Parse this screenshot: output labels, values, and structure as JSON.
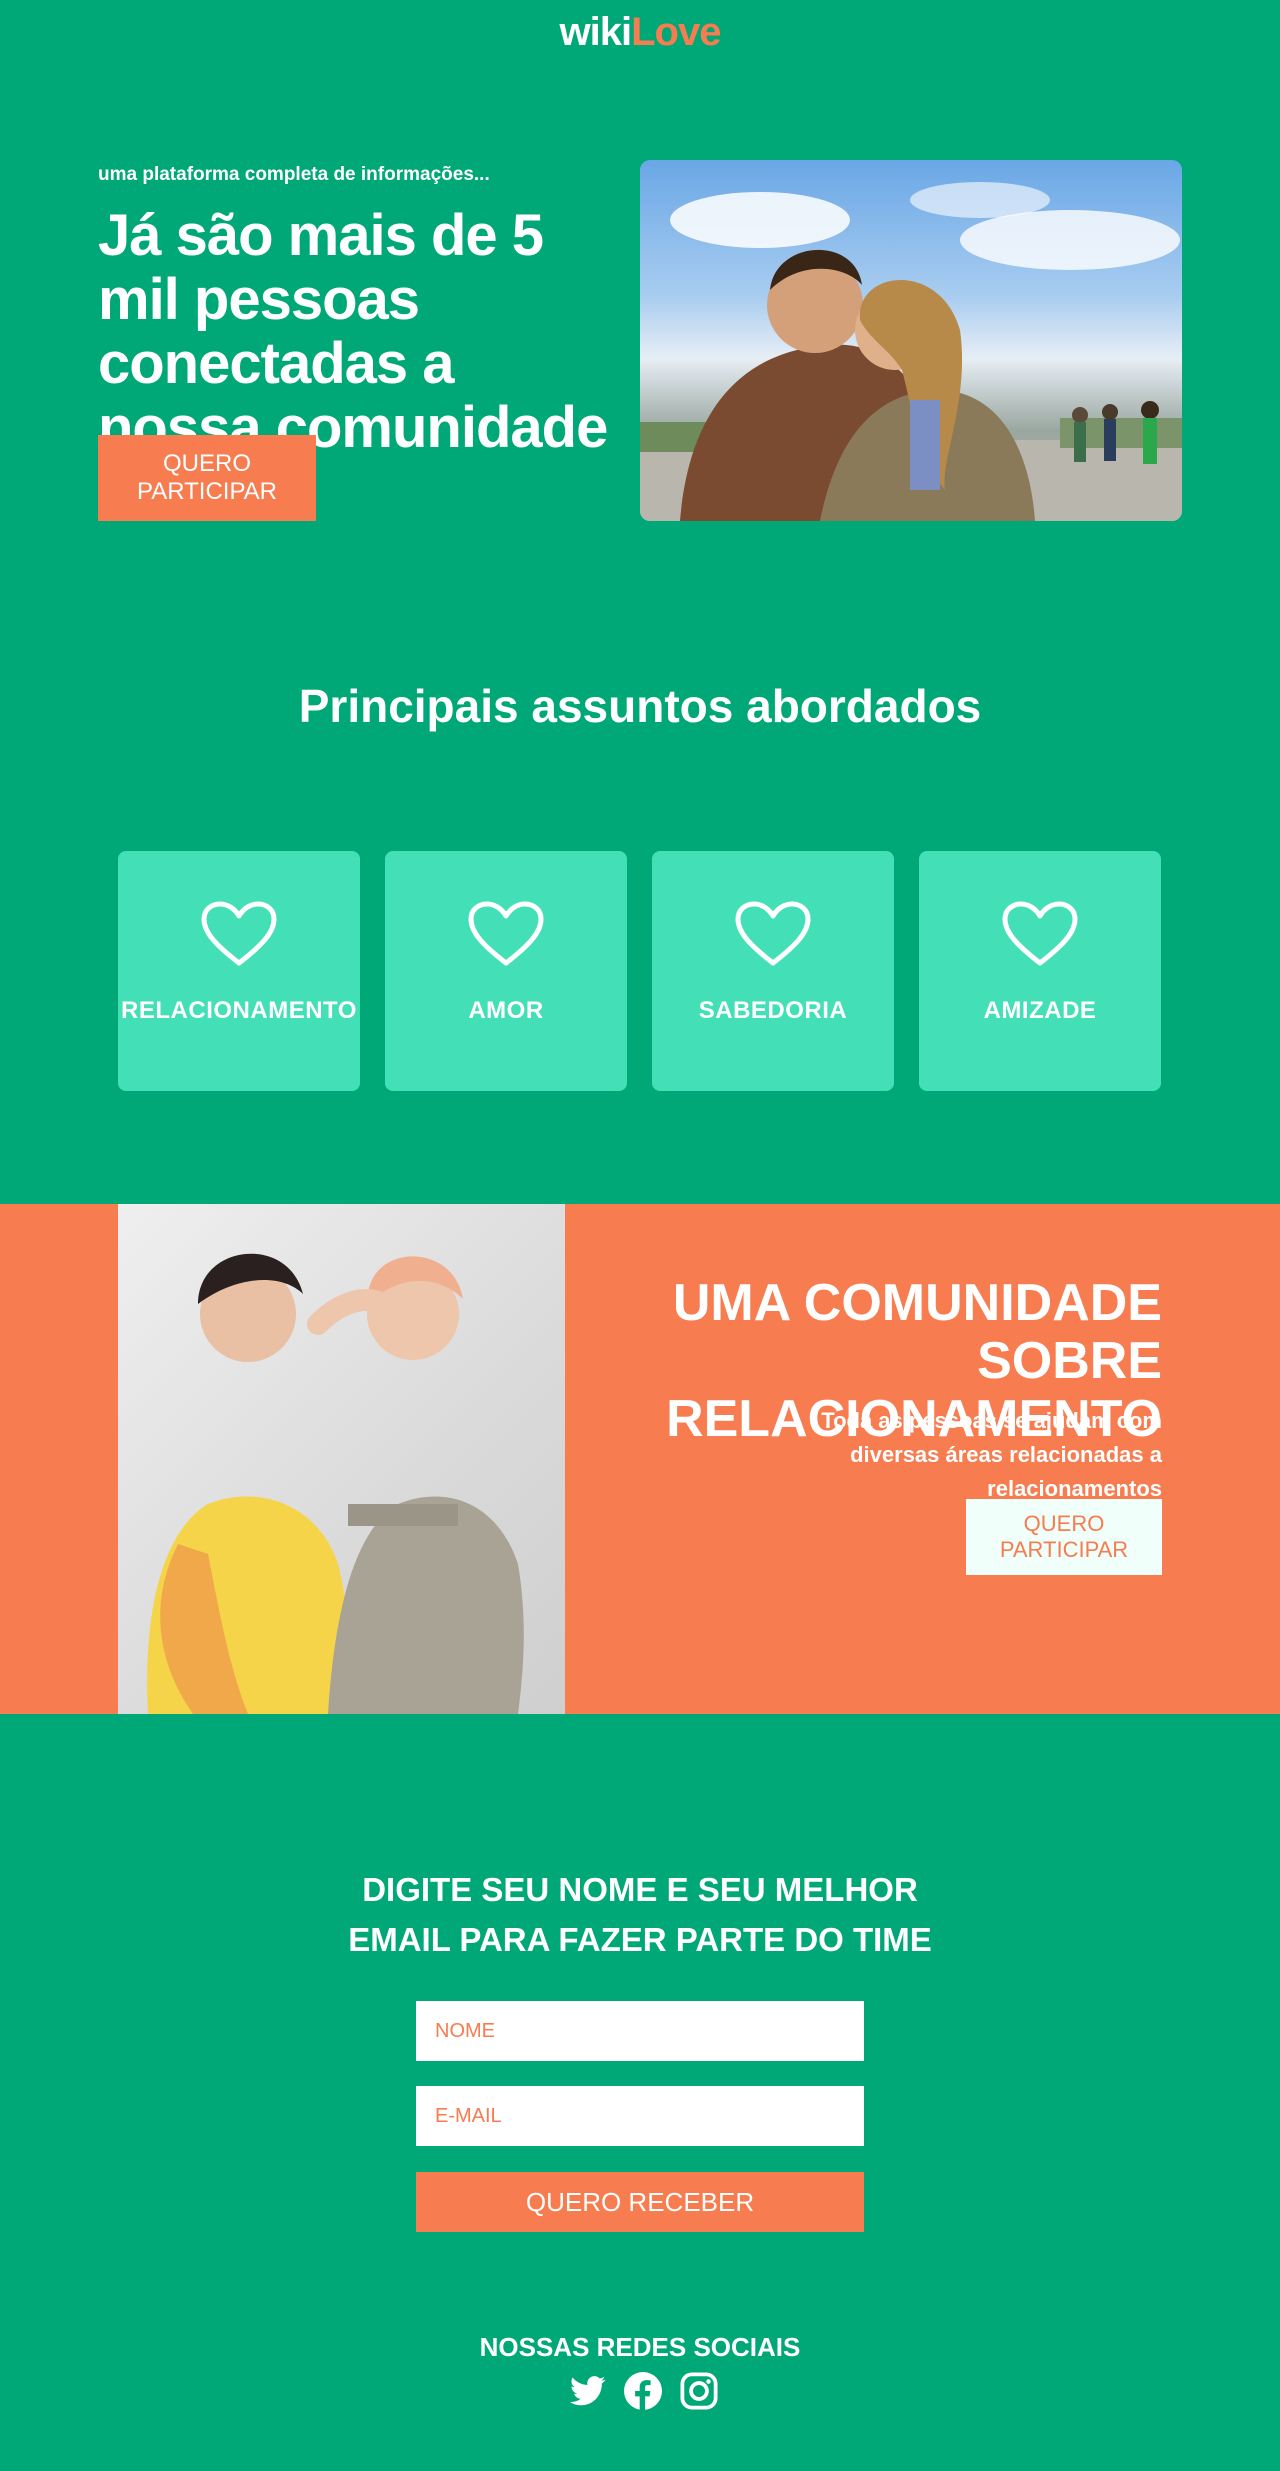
{
  "header": {
    "logo_part1": "wiki",
    "logo_part2": "Love"
  },
  "hero": {
    "tagline": "uma plataforma completa de informações...",
    "title": "Já são mais de 5 mil pessoas conectadas a nossa comunidade",
    "button_label": "QUERO PARTICIPAR"
  },
  "topics": {
    "title": "Principais assuntos abordados",
    "items": [
      {
        "label": "RELACIONAMENTO",
        "icon": "heart-icon"
      },
      {
        "label": "AMOR",
        "icon": "heart-icon"
      },
      {
        "label": "SABEDORIA",
        "icon": "heart-icon"
      },
      {
        "label": "AMIZADE",
        "icon": "heart-icon"
      }
    ]
  },
  "community": {
    "title": "UMA COMUNIDADE SOBRE RELACIONAMENTO",
    "description": "Toda as pessoas se ajudam com diversas áreas relacionadas a relacionamentos",
    "button_label": "QUERO PARTICIPAR"
  },
  "signup": {
    "title_line1": "DIGITE SEU NOME E SEU MELHOR",
    "title_line2": "EMAIL PARA FAZER PARTE DO TIME",
    "name_placeholder": "NOME",
    "email_placeholder": "E-MAIL",
    "submit_label": "QUERO RECEBER"
  },
  "social": {
    "title": "NOSSAS REDES SOCIAIS",
    "icons": [
      "twitter-icon",
      "facebook-icon",
      "instagram-icon"
    ]
  },
  "colors": {
    "green": "#00a878",
    "mint": "#43e0b7",
    "orange": "#f77c4f",
    "light": "#f0fff9"
  }
}
